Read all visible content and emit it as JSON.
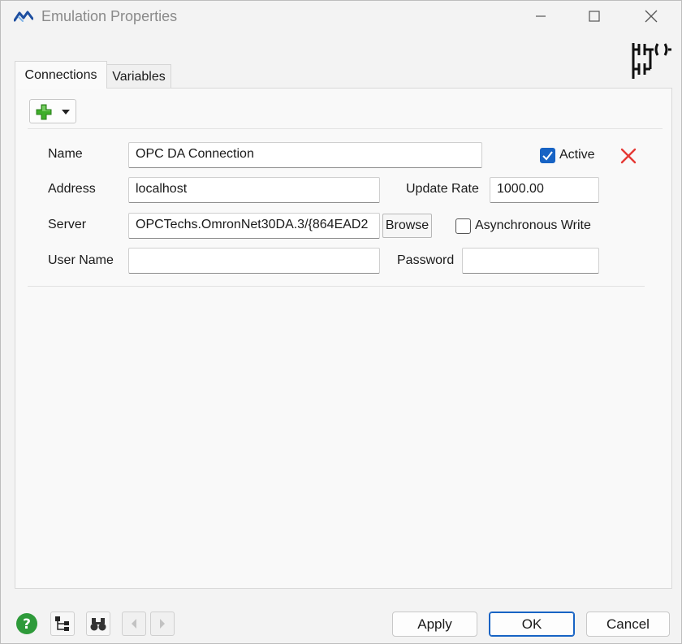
{
  "window": {
    "title": "Emulation Properties",
    "app_icon": "flexsim-logo-icon",
    "logo_icon": "ladder-logic-icon"
  },
  "tabs": [
    {
      "label": "Connections",
      "active": true
    },
    {
      "label": "Variables",
      "active": false
    }
  ],
  "toolbar": {
    "add_icon": "green-plus-icon",
    "dropdown_icon": "caret-down-icon"
  },
  "form": {
    "name_label": "Name",
    "name_value": "OPC DA Connection",
    "active_label": "Active",
    "active_checked": true,
    "address_label": "Address",
    "address_value": "localhost",
    "update_rate_label": "Update Rate",
    "update_rate_value": "1000.00",
    "server_label": "Server",
    "server_value": "OPCTechs.OmronNet30DA.3/{864EAD2",
    "browse_label": "Browse",
    "async_write_label": "Asynchronous Write",
    "async_write_checked": false,
    "username_label": "User Name",
    "username_value": "",
    "password_label": "Password",
    "password_value": "",
    "delete_icon": "red-x-icon"
  },
  "footer": {
    "apply_label": "Apply",
    "ok_label": "OK",
    "cancel_label": "Cancel"
  },
  "colors": {
    "accent": "#1763c4",
    "delete": "#e53935",
    "add": "#3fae2a",
    "help": "#2e9a3a"
  }
}
